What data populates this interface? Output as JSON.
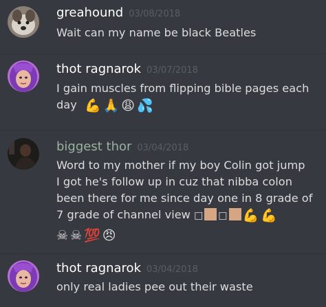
{
  "messages": [
    {
      "username": "greahound",
      "username_color": "#ffffff",
      "timestamp": "03/08/2018",
      "lines": [
        "Wait can my name be black Beatles"
      ],
      "avatar": "dog-avatar"
    },
    {
      "username": "thot ragnarok",
      "username_color": "#ffffff",
      "timestamp": "03/07/2018",
      "lines": [
        "I gain muscles from flipping bible pages each",
        "day"
      ],
      "emojis": [
        "💪",
        "🙏",
        "😩",
        "💦"
      ],
      "avatar": "purple-hair-avatar"
    },
    {
      "username": "biggest thor",
      "username_color": "#9ab39f",
      "timestamp": "03/04/2018",
      "lines": [
        "Word to my mother if my boy Colin got jump",
        "I got he's follow up in cuz that nibba colon",
        "been there for me since day one in 8 grade of",
        "7 grade of channel view"
      ],
      "line4_glyphs": [
        "□",
        "□"
      ],
      "line4_emojis": [
        "💪",
        "💪"
      ],
      "line5_emojis": [
        "☠",
        "☠",
        "💯",
        "😠"
      ],
      "avatar": "dark-photo-avatar"
    },
    {
      "username": "thot ragnarok",
      "username_color": "#ffffff",
      "timestamp": "03/04/2018",
      "lines": [
        "only real ladies pee out their waste"
      ],
      "avatar": "purple-hair-avatar"
    }
  ]
}
